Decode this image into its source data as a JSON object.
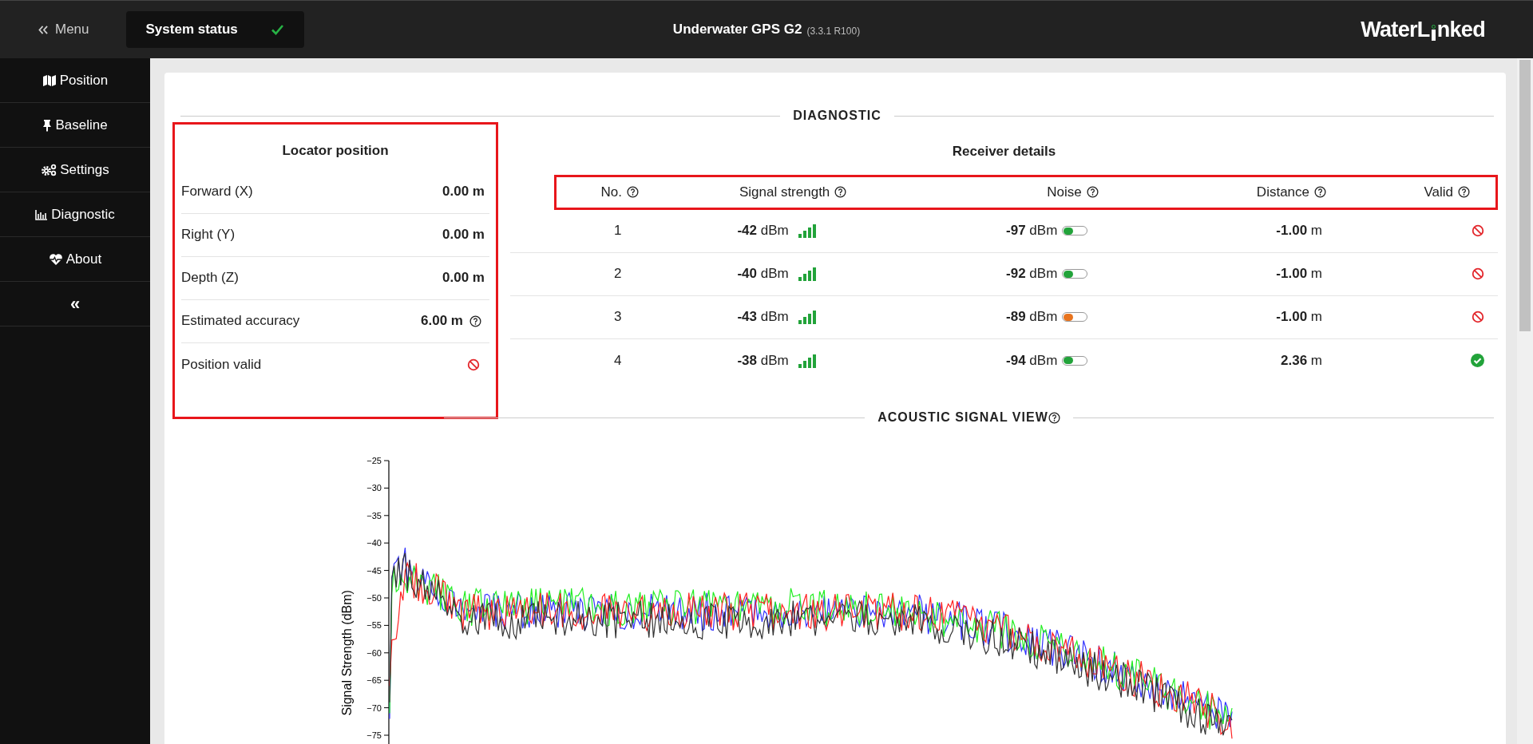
{
  "header": {
    "menu_label": "Menu",
    "system_status": {
      "label": "System status",
      "ok": true
    },
    "title": "Underwater GPS G2",
    "version": "(3.3.1 R100)",
    "logo": {
      "before": "WaterL",
      "after": "nked"
    }
  },
  "sidebar": {
    "items": [
      {
        "label": "Position"
      },
      {
        "label": "Baseline"
      },
      {
        "label": "Settings"
      },
      {
        "label": "Diagnostic"
      },
      {
        "label": "About"
      }
    ],
    "collapse": "«"
  },
  "diagnostic": {
    "heading": "DIAGNOSTIC",
    "locator": {
      "title": "Locator position",
      "highlighted": true,
      "rows": [
        {
          "label": "Forward (X)",
          "kind": "value",
          "value": "0.00 m",
          "help": false
        },
        {
          "label": "Right (Y)",
          "kind": "value",
          "value": "0.00 m",
          "help": false
        },
        {
          "label": "Depth (Z)",
          "kind": "value",
          "value": "0.00 m",
          "help": false
        },
        {
          "label": "Estimated accuracy",
          "kind": "value",
          "value": "6.00 m",
          "help": true
        },
        {
          "label": "Position valid",
          "kind": "validity",
          "valid": false
        }
      ]
    },
    "receivers": {
      "title": "Receiver details",
      "header_highlighted": true,
      "columns": [
        "No.",
        "Signal strength",
        "Noise",
        "Distance",
        "Valid"
      ],
      "rows": [
        {
          "no": "1",
          "signal": "-42",
          "signal_unit": "dBm",
          "noise": "-97",
          "noise_unit": "dBm",
          "color": "#22a33a",
          "distance": "-1.00",
          "distance_unit": "m",
          "valid": false
        },
        {
          "no": "2",
          "signal": "-40",
          "signal_unit": "dBm",
          "noise": "-92",
          "noise_unit": "dBm",
          "color": "#22a33a",
          "distance": "-1.00",
          "distance_unit": "m",
          "valid": false
        },
        {
          "no": "3",
          "signal": "-43",
          "signal_unit": "dBm",
          "noise": "-89",
          "noise_unit": "dBm",
          "color": "#e8741e",
          "distance": "-1.00",
          "distance_unit": "m",
          "valid": false
        },
        {
          "no": "4",
          "signal": "-38",
          "signal_unit": "dBm",
          "noise": "-94",
          "noise_unit": "dBm",
          "color": "#22a33a",
          "distance": "2.36",
          "distance_unit": "m",
          "valid": true
        }
      ]
    }
  },
  "acoustic": {
    "heading": "ACOUSTIC SIGNAL VIEW",
    "ylabel": "Signal Strength (dBm)",
    "yticks": [
      "−25",
      "−30",
      "−35",
      "−40",
      "−45",
      "−50",
      "−55",
      "−60",
      "−65",
      "−70",
      "−75"
    ]
  }
}
